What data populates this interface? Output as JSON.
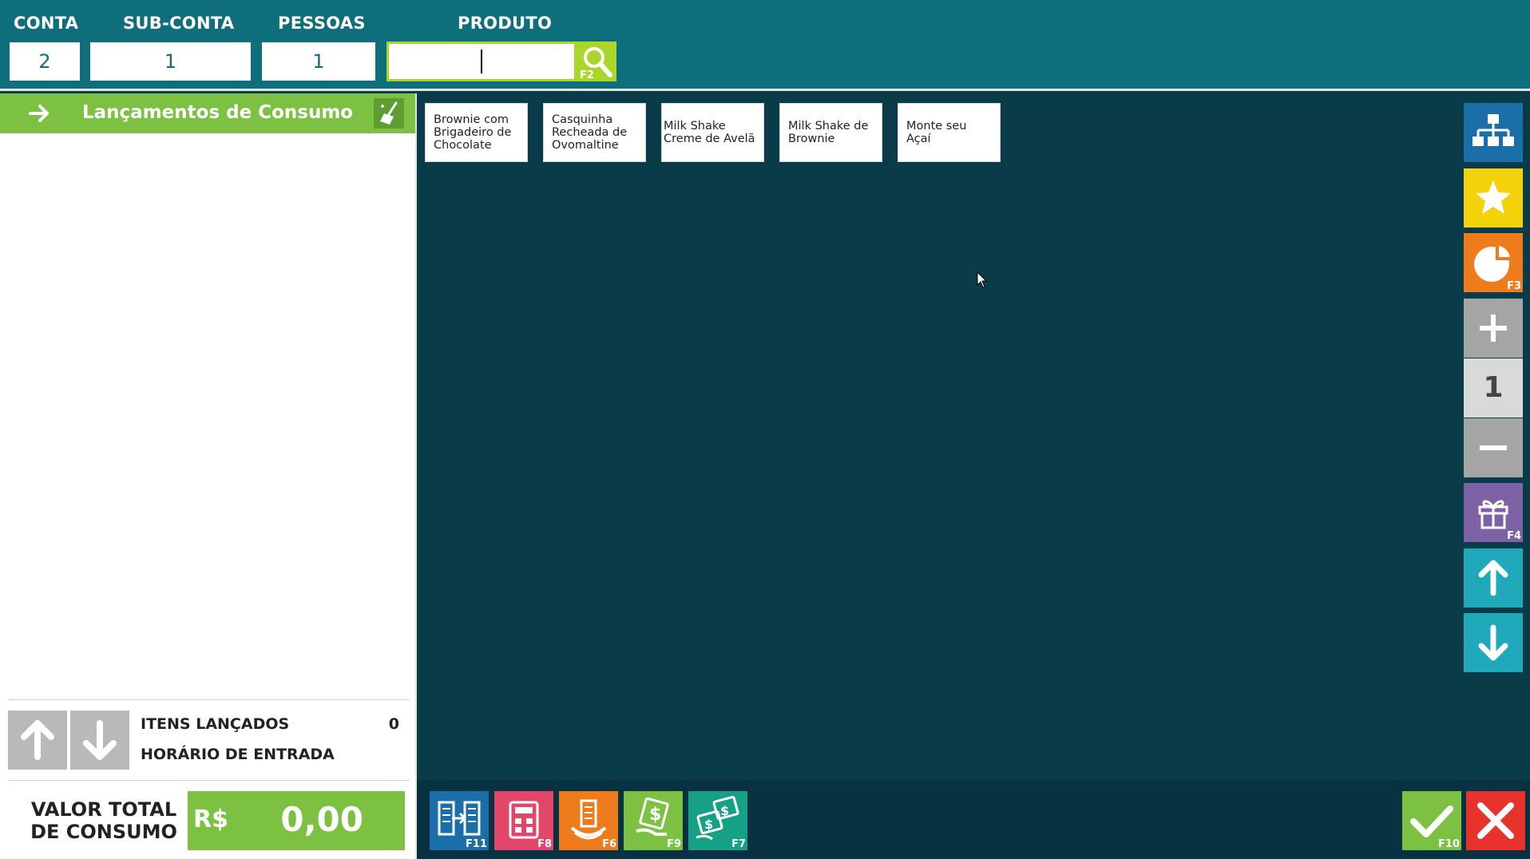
{
  "header": {
    "conta_label": "CONTA",
    "conta_value": "2",
    "subconta_label": "SUB-CONTA",
    "subconta_value": "1",
    "pessoas_label": "PESSOAS",
    "pessoas_value": "1",
    "produto_label": "PRODUTO",
    "produto_value": "",
    "search_key": "F2"
  },
  "left_panel": {
    "title": "Lançamentos de Consumo",
    "itens_label": "ITENS LANÇADOS",
    "itens_value": "0",
    "horario_label": "HORÁRIO DE ENTRADA",
    "horario_value": "",
    "total_label_line1": "VALOR TOTAL",
    "total_label_line2": "DE CONSUMO",
    "currency": "R$",
    "total_value": "0,00"
  },
  "products": [
    "Brownie com Brigadeiro de Chocolate",
    "Casquinha Recheada de Ovomaltine",
    "Milk Shake Creme de Avelã",
    "Milk Shake de Brownie",
    "Monte seu Açaí"
  ],
  "side_toolbar": {
    "tree_icon": "tree-icon",
    "star_icon": "star-icon",
    "pie_icon": "pie-chart-icon",
    "pie_key": "F3",
    "quantity": "1",
    "gift_key": "F4"
  },
  "bottom_toolbar": {
    "transfer_key": "F11",
    "calculator_key": "F8",
    "receipt_key": "F6",
    "payment_key": "F9",
    "split_payment_key": "F7",
    "confirm_key": "F10"
  },
  "colors": {
    "header_teal": "#0e6e7c",
    "main_dark": "#0a3b49",
    "green": "#7cc142",
    "lime": "#a8d62a",
    "blue": "#1b6fa8",
    "yellow": "#f3d20a",
    "orange": "#ee7b1c",
    "gray": "#a5a5a5",
    "purple": "#7e62a6",
    "cyan": "#1fa9bb",
    "pink": "#e2476a",
    "red": "#e8332d"
  }
}
